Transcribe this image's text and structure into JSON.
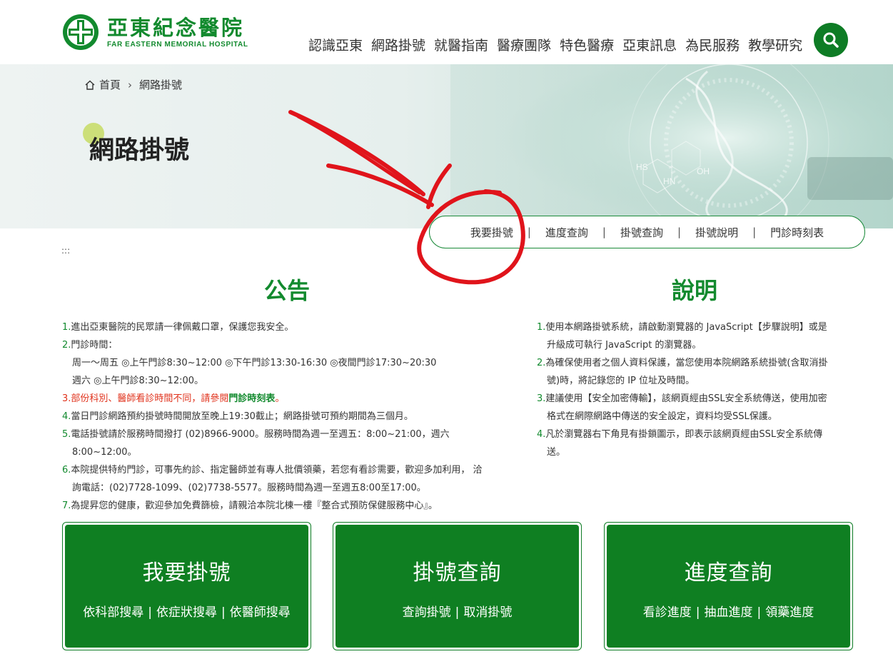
{
  "logo": {
    "cn": "亞東紀念醫院",
    "en": "FAR EASTERN MEMORIAL HOSPITAL"
  },
  "nav": [
    "認識亞東",
    "網路掛號",
    "就醫指南",
    "醫療團隊",
    "特色醫療",
    "亞東訊息",
    "為民服務",
    "教學研究"
  ],
  "breadcrumb": {
    "home": "首頁",
    "current": "網路掛號"
  },
  "page_title": "網路掛號",
  "subnav": [
    "我要掛號",
    "進度查詢",
    "掛號查詢",
    "掛號說明",
    "門診時刻表"
  ],
  "skip_marker": ":::",
  "announcement": {
    "title": "公告",
    "items": {
      "i1": {
        "n": "1.",
        "t": "進出亞東醫院的民眾請一律佩戴口罩，保護您我安全。"
      },
      "i2": {
        "n": "2.",
        "t": "門診時間：",
        "l2": "周一～周五 ◎上午門診8:30~12:00 ◎下午門診13:30-16:30 ◎夜間門診17:30~20:30",
        "l3": "週六 ◎上午門診8:30~12:00。"
      },
      "i3": {
        "n": "3.",
        "t": "部份科別、醫師看診時間不同，請參閱",
        "link": "門診時刻表",
        "end": "。"
      },
      "i4": {
        "n": "4.",
        "t": "當日門診網路預約掛號時間開放至晚上19:30截止；網路掛號可預約期間為三個月。"
      },
      "i5": {
        "n": "5.",
        "t": "電話掛號請於服務時間撥打 (02)8966-9000。服務時間為週一至週五：8:00~21:00，週六",
        "l2": "8:00~12:00。"
      },
      "i6": {
        "n": "6.",
        "t": "本院提供特約門診，可事先約診、指定醫師並有專人批價領藥，若您有看診需要，歡迎多加利用， 洽",
        "l2": "詢電話：(02)7728-1099、(02)7738-5577。服務時間為週一至週五8:00至17:00。"
      },
      "i7": {
        "n": "7.",
        "t": "為提昇您的健康，歡迎參加免費篩檢，請親洽本院北棟一樓『整合式預防保健服務中心』。"
      }
    }
  },
  "instructions": {
    "title": "說明",
    "items": {
      "i1": {
        "n": "1.",
        "t": "使用本網路掛號系統，請啟動瀏覽器的 JavaScript【步驟說明】或是",
        "l2": "升級成可執行 JavaScript 的瀏覽器。"
      },
      "i2": {
        "n": "2.",
        "t": "為確保使用者之個人資料保護，當您使用本院網路系統掛號(含取消掛",
        "l2": "號)時，將記錄您的 IP 位址及時間。"
      },
      "i3": {
        "n": "3.",
        "t": "建議使用【安全加密傳輸】，該網頁經由SSL安全系統傳送，使用加密",
        "l2": "格式在網際網路中傳送的安全設定，資料均受SSL保護。"
      },
      "i4": {
        "n": "4.",
        "t": "凡於瀏覽器右下角見有掛鎖圖示，即表示該網頁經由SSL安全系統傳",
        "l2": "送。"
      }
    }
  },
  "cards": {
    "c1": {
      "title": "我要掛號",
      "links": [
        "依科部搜尋",
        "依症狀搜尋",
        "依醫師搜尋"
      ]
    },
    "c2": {
      "title": "掛號查詢",
      "links": [
        "查詢掛號",
        "取消掛號"
      ]
    },
    "c3": {
      "title": "進度查詢",
      "links": [
        "看診進度",
        "抽血進度",
        "領藥進度"
      ]
    }
  },
  "colors": {
    "brand_green": "#128a2e",
    "card_green": "#0f7f22",
    "alert_red": "#e0321c",
    "annotation_red": "#e0141b"
  }
}
